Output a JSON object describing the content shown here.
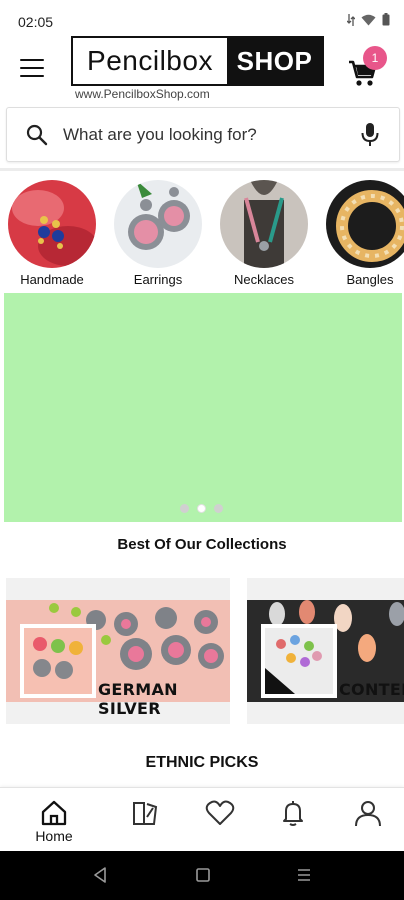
{
  "status_bar": {
    "time": "02:05",
    "icons": [
      "data-arrows-icon",
      "wifi-icon",
      "battery-icon"
    ]
  },
  "header": {
    "logo_left": "Pencilbox",
    "logo_right": "SHOP",
    "logo_url": "www.PencilboxShop.com",
    "cart_count": "1",
    "accent_color": "#e8568a"
  },
  "search": {
    "placeholder": "What are you looking for?"
  },
  "categories": [
    {
      "label": "Handmade"
    },
    {
      "label": "Earrings"
    },
    {
      "label": "Necklaces"
    },
    {
      "label": "Bangles"
    }
  ],
  "banner": {
    "color": "#b2f2ac",
    "slide_count": 3,
    "active_slide": 2
  },
  "collections": {
    "title": "Best Of Our Collections",
    "cards": [
      {
        "label": "GERMAN SILVER"
      },
      {
        "label": "CONTEMPO"
      }
    ]
  },
  "ethnic": {
    "title": "ETHNIC PICKS"
  },
  "bottom_nav": {
    "items": [
      {
        "label": "Home",
        "icon": "home-icon"
      },
      {
        "label": "",
        "icon": "catalog-icon"
      },
      {
        "label": "",
        "icon": "heart-icon"
      },
      {
        "label": "",
        "icon": "bell-icon"
      },
      {
        "label": "",
        "icon": "user-icon"
      }
    ]
  }
}
